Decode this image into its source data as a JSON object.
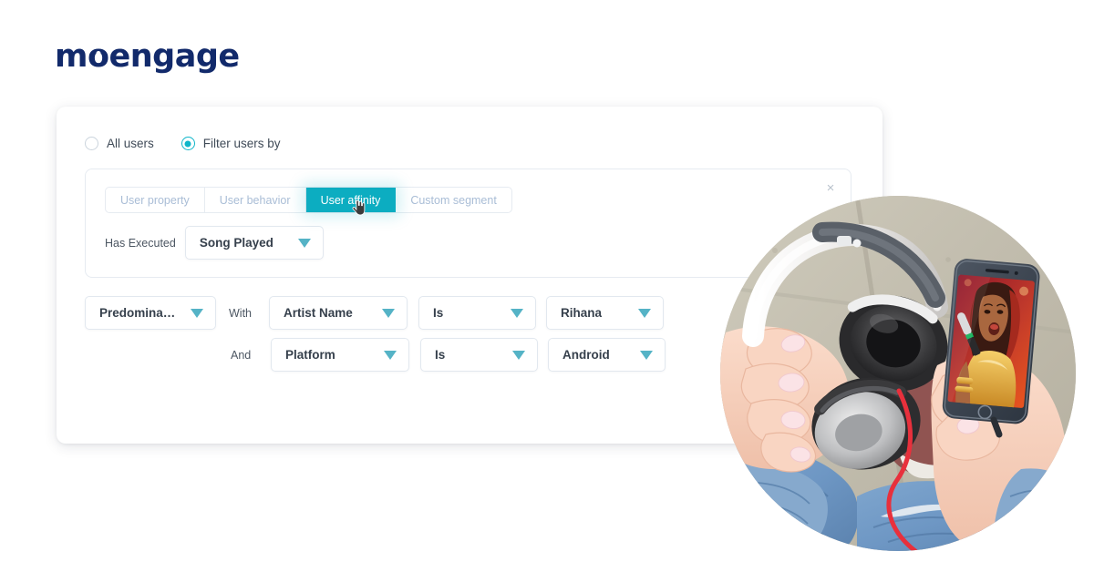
{
  "brand": {
    "logo_part1": "m",
    "logo_part2": "o",
    "logo_part3": "engage",
    "logo_full": "moengage",
    "logo_color": "#122A6B",
    "accent_color": "#0CADC1",
    "caret_color": "#55B3C6"
  },
  "audience": {
    "options": [
      {
        "label": "All users",
        "selected": false
      },
      {
        "label": "Filter users by",
        "selected": true
      }
    ]
  },
  "filter_panel": {
    "close_label": "×",
    "tabs": [
      {
        "label": "User property",
        "active": false
      },
      {
        "label": "User behavior",
        "active": false
      },
      {
        "label": "User affinity",
        "active": true
      },
      {
        "label": "Custom segment",
        "active": false
      }
    ],
    "cursor_icon": "hand-pointer-icon",
    "executed": {
      "label": "Has Executed",
      "event": "Song Played"
    }
  },
  "conditions": {
    "affinity": {
      "label": "Predominantly"
    },
    "rows": [
      {
        "conjunction": "With",
        "attribute": "Artist Name",
        "operator": "Is",
        "value": "Rihana"
      },
      {
        "conjunction": "And",
        "attribute": "Platform",
        "operator": "Is",
        "value": "Android"
      }
    ]
  },
  "photo": {
    "alt": "Person holding headphones in one hand and a smartphone showing a singer performing on stage"
  }
}
